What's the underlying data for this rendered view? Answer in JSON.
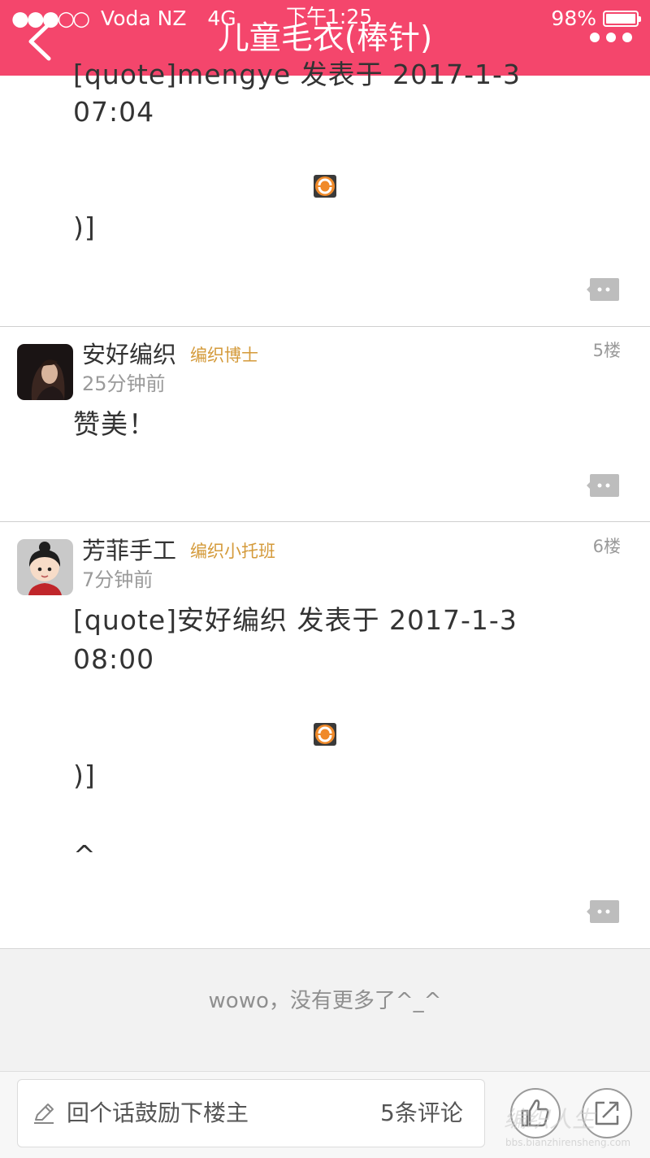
{
  "status_bar": {
    "carrier": "Voda NZ",
    "network": "4G",
    "time": "下午1:25",
    "battery": "98%",
    "battery_level": 0.98
  },
  "header": {
    "title": "儿童毛衣(棒针)",
    "background": "#f4466c"
  },
  "posts": [
    {
      "lines": [
        "[quote]mengye 发表于 2017-1-3",
        "07:04",
        "",
        ")]"
      ],
      "emoji": "smiley-icon"
    },
    {
      "username": "安好编织",
      "rank": "编织博士",
      "time": "25分钟前",
      "floor": "5楼",
      "content": "赞美！"
    },
    {
      "username": "芳菲手工",
      "rank": "编织小托班",
      "time": "7分钟前",
      "floor": "6楼",
      "lines": [
        "[quote]安好编织 发表于 2017-1-3",
        "08:00",
        ")]",
        "^"
      ],
      "emoji": "smiley-icon"
    }
  ],
  "end_message": "wowo，没有更多了^_^",
  "bottom_bar": {
    "reply_placeholder": "回个话鼓励下楼主",
    "comment_count": "5条评论"
  },
  "watermark": {
    "logo": "编织人生",
    "url": "bbs.bianzhirensheng.com"
  },
  "colors": {
    "accent": "#f4466c",
    "rank": "#d49a3a",
    "muted": "#9a9a9a"
  }
}
